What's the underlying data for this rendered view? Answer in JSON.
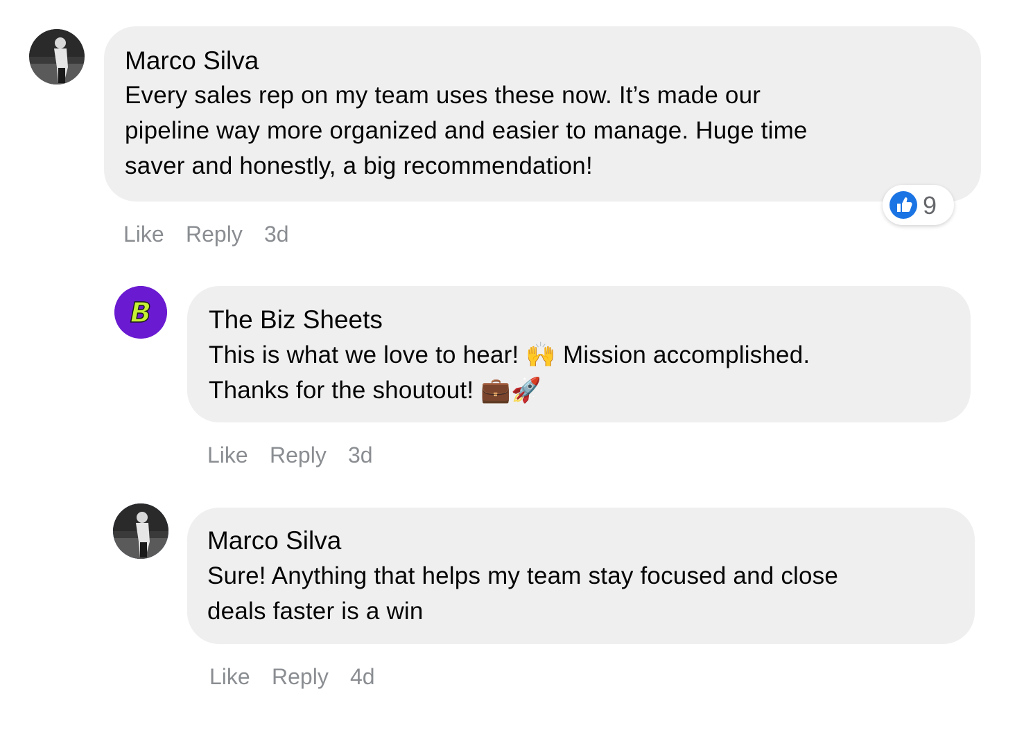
{
  "comments": [
    {
      "author": "Marco Silva",
      "lines": [
        "Every sales rep on my team uses these now. It’s made our",
        "pipeline way more organized and easier to manage. Huge time",
        "saver and honestly, a big recommendation!"
      ],
      "like_label": "Like",
      "reply_label": "Reply",
      "time": "3d",
      "reaction_icon": "thumbs-up-icon",
      "reaction_count": "9"
    },
    {
      "author": "The Biz Sheets",
      "line1_a": "This is what we love to hear! ",
      "line1_emoji": "🙌",
      "line1_b": " Mission accomplished.",
      "line2_a": "Thanks for the shoutout! ",
      "line2_emoji": "💼🚀",
      "like_label": "Like",
      "reply_label": "Reply",
      "time": "3d"
    },
    {
      "author": "Marco Silva",
      "lines": [
        "Sure! Anything that helps my team stay focused and close",
        "deals faster is a win"
      ],
      "like_label": "Like",
      "reply_label": "Reply",
      "time": "4d"
    }
  ],
  "colors": {
    "bubble": "#efefef",
    "meta_text": "#8a8d91",
    "like_blue": "#1b74e4",
    "biz_avatar_bg": "#6a1bd1",
    "biz_logo": "#c6f035"
  }
}
